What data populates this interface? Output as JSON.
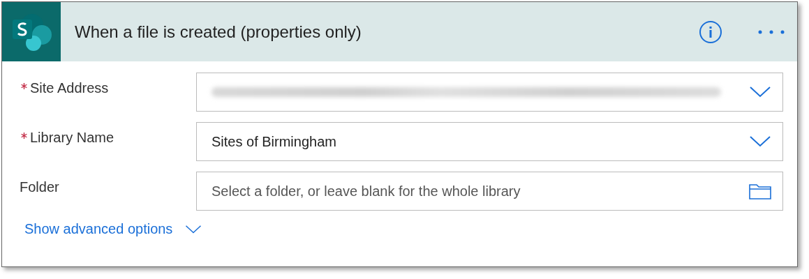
{
  "header": {
    "title": "When a file is created (properties only)"
  },
  "fields": [
    {
      "label": "Site Address",
      "required": true,
      "kind": "redacted"
    },
    {
      "label": "Library Name",
      "required": true,
      "kind": "dropdown",
      "value": "Sites of Birmingham"
    },
    {
      "label": "Folder",
      "required": false,
      "kind": "folder",
      "placeholder": "Select a folder, or leave blank for the whole library"
    }
  ],
  "advanced_link": "Show advanced options"
}
